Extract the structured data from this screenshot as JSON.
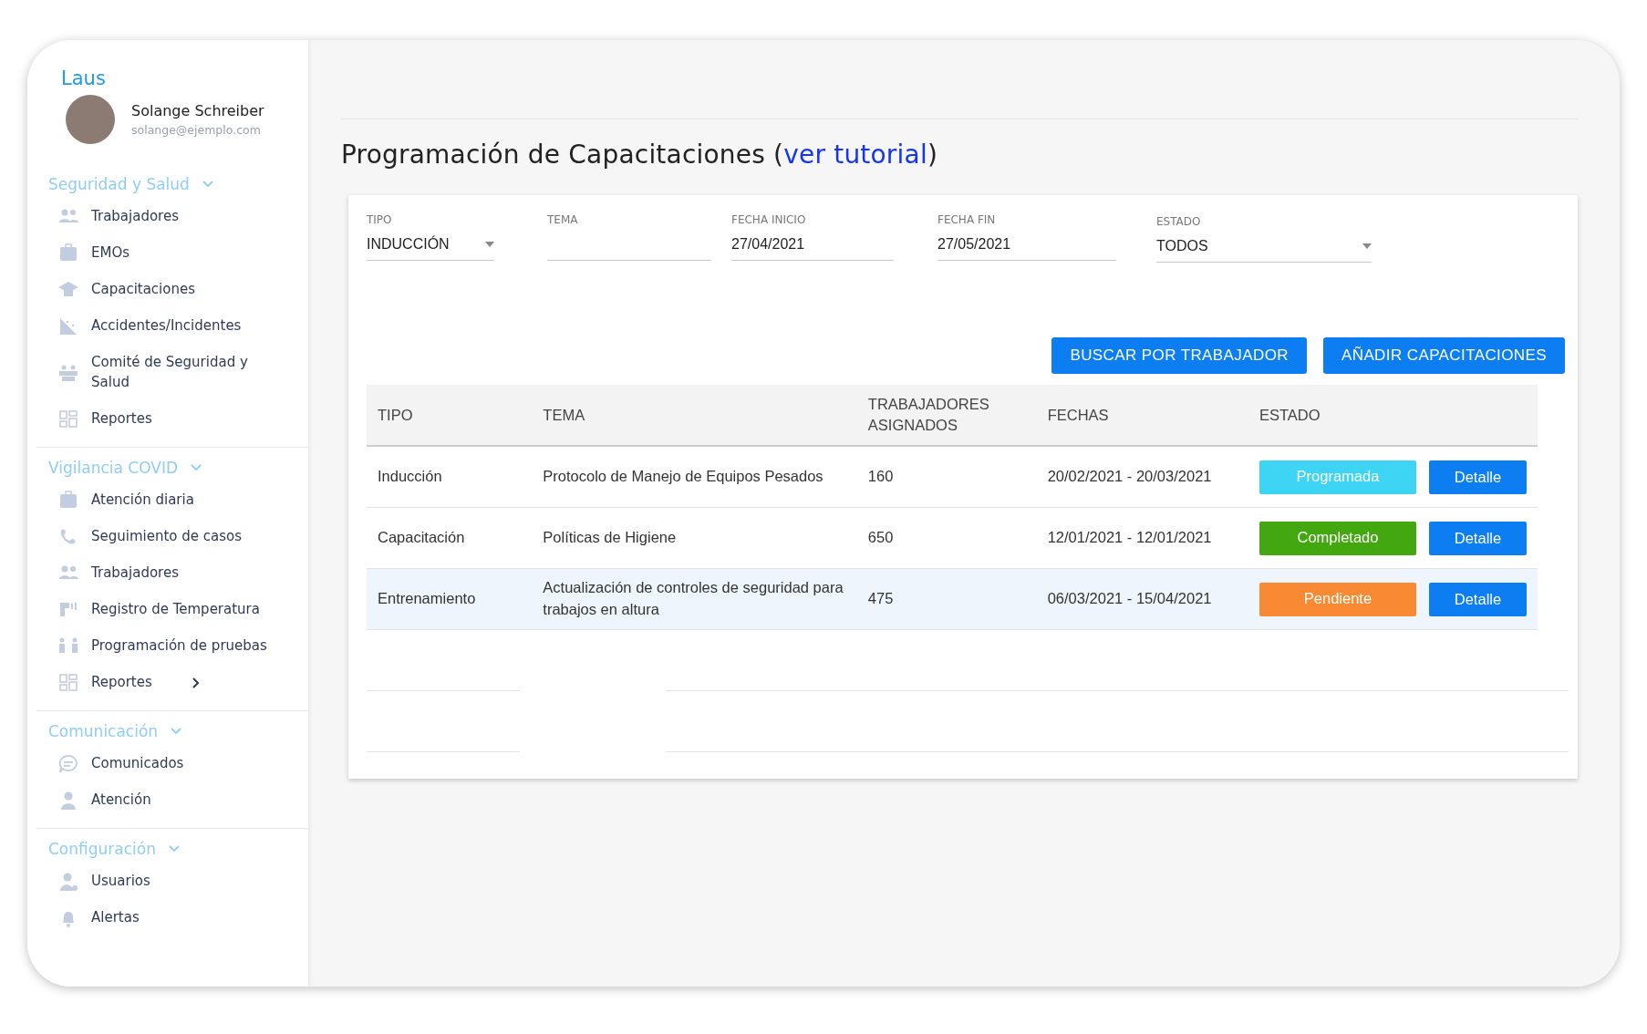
{
  "sidebar": {
    "brand": "Laus",
    "user": {
      "name": "Solange Schreiber",
      "email": "solange@ejemplo.com"
    },
    "sections": [
      {
        "title": "Seguridad y Salud",
        "expanded": true,
        "items": [
          {
            "label": "Trabajadores"
          },
          {
            "label": "EMOs"
          },
          {
            "label": "Capacitaciones"
          },
          {
            "label": "Accidentes/Incidentes"
          },
          {
            "label": "Comité de Seguridad y Salud"
          },
          {
            "label": "Reportes"
          }
        ]
      },
      {
        "title": "Vigilancia COVID",
        "expanded": true,
        "items": [
          {
            "label": "Atención diaria"
          },
          {
            "label": "Seguimiento de casos"
          },
          {
            "label": "Trabajadores"
          },
          {
            "label": "Registro de Temperatura"
          },
          {
            "label": "Programación de pruebas"
          },
          {
            "label": "Reportes",
            "submenu": true
          }
        ]
      },
      {
        "title": "Comunicación",
        "expanded": true,
        "items": [
          {
            "label": "Comunicados"
          },
          {
            "label": "Atención"
          }
        ]
      },
      {
        "title": "Configuración",
        "expanded": true,
        "items": [
          {
            "label": "Usuarios"
          },
          {
            "label": "Alertas"
          }
        ]
      }
    ]
  },
  "page": {
    "title": "Programación de Capacitaciones",
    "paren_open": "(",
    "link": "ver tutorial",
    "paren_close": ")"
  },
  "filters": [
    {
      "label": "TIPO",
      "value": "INDUCCIÓN",
      "kind": "select"
    },
    {
      "label": "TEMA",
      "kind": "text"
    },
    {
      "label": "FECHA INICIO",
      "value": "27/04/2021",
      "kind": "text"
    },
    {
      "label": "FECHA FIN",
      "value": "27/05/2021",
      "kind": "text"
    },
    {
      "label": "ESTADO",
      "value": "TODOS",
      "kind": "select"
    }
  ],
  "actions": [
    "BUSCAR POR TRABAJADOR",
    "AÑADIR CAPACITACIONES"
  ],
  "table": {
    "columns": [
      "TIPO",
      "TEMA",
      "TRABAJADORES ASIGNADOS",
      "FECHAS",
      "ESTADO"
    ],
    "rows": [
      {
        "tipo": "Inducción",
        "tema": "Protocolo de Manejo de Equipos Pesados",
        "trabajadores": "160",
        "fechas": "20/02/2021 - 20/03/2021",
        "estado": {
          "label": "Programada",
          "color": "#3dd5f3"
        },
        "action": "Detalle",
        "selected": false
      },
      {
        "tipo": "Capacitación",
        "tema": "Políticas de Higiene",
        "trabajadores": "650",
        "fechas": "12/01/2021 - 12/01/2021",
        "estado": {
          "label": "Completado",
          "color": "#43a80f"
        },
        "action": "Detalle",
        "selected": false
      },
      {
        "tipo": "Entrenamiento",
        "tema": "Actualización de controles de seguridad para trabajos en altura",
        "trabajadores": "475",
        "fechas": "06/03/2021 - 15/04/2021",
        "estado": {
          "label": "Pendiente",
          "color": "#f98a33"
        },
        "action": "Detalle",
        "selected": true
      }
    ]
  }
}
